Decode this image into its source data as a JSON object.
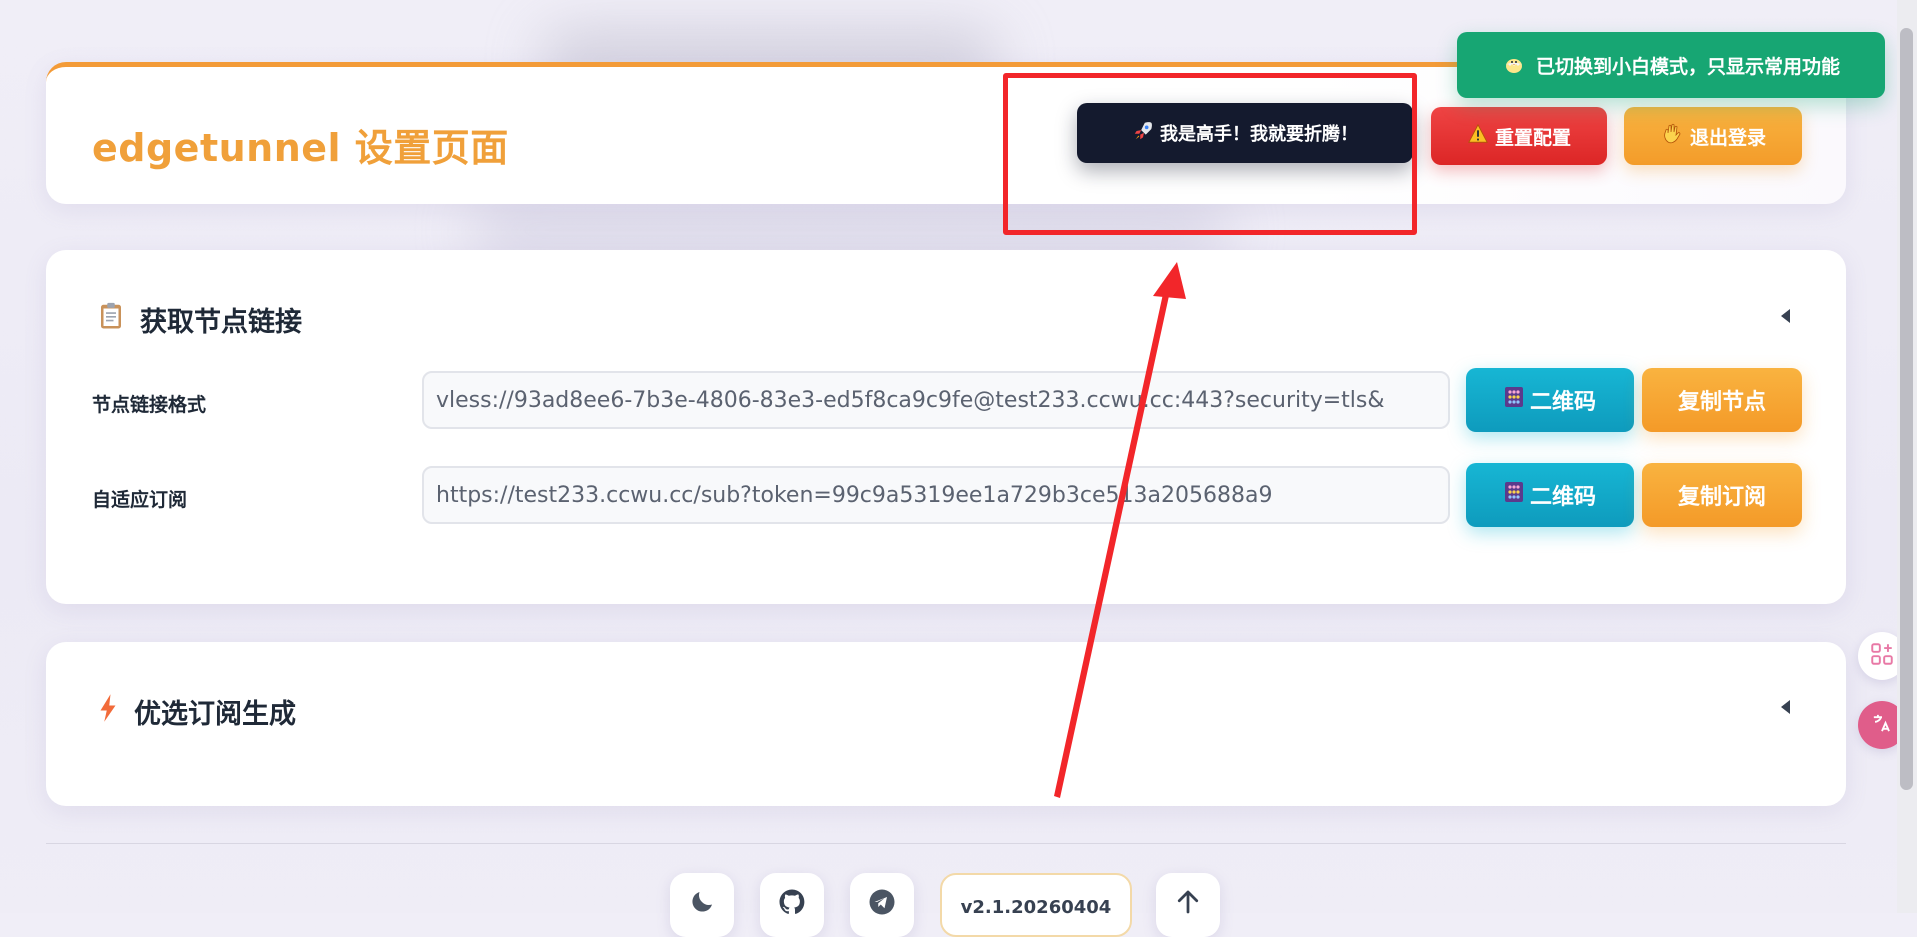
{
  "header": {
    "title": "edgetunnel 设置页面",
    "expert_button": "我是高手！我就要折腾！",
    "reset_button": "重置配置",
    "logout_button": "退出登录"
  },
  "toast": {
    "message": "已切换到小白模式，只显示常用功能"
  },
  "node_section": {
    "title": "获取节点链接",
    "fields": [
      {
        "label": "节点链接格式",
        "value": "vless://93ad8ee6-7b3e-4806-83e3-ed5f8ca9c9fe@test233.ccwu.cc:443?security=tls&",
        "qr_button": "二维码",
        "copy_button": "复制节点"
      },
      {
        "label": "自适应订阅",
        "value": "https://test233.ccwu.cc/sub?token=99c9a5319ee1a729b3ce513a205688a9",
        "qr_button": "二维码",
        "copy_button": "复制订阅"
      }
    ]
  },
  "optimize_section": {
    "title": "优选订阅生成"
  },
  "footer": {
    "version": "v2.1.20260404"
  },
  "icons": {
    "expert": "rocket-icon",
    "reset": "warning-icon",
    "logout": "wave-hand-icon",
    "toast": "chick-icon",
    "node_section": "clipboard-icon",
    "optimize_section": "lightning-icon",
    "qr": "abacus-icon",
    "theme": "moon-icon",
    "github": "github-icon",
    "telegram": "telegram-icon",
    "top": "arrow-up-icon",
    "side_apps": "apps-icon",
    "side_translate": "translate-icon"
  },
  "colors": {
    "accent_orange": "#f0a03a",
    "danger_red": "#dc2626",
    "success_green": "#17a673",
    "qr_cyan": "#17b6d4",
    "dark_button": "#141a2e",
    "annotation_red": "#f2262a"
  }
}
